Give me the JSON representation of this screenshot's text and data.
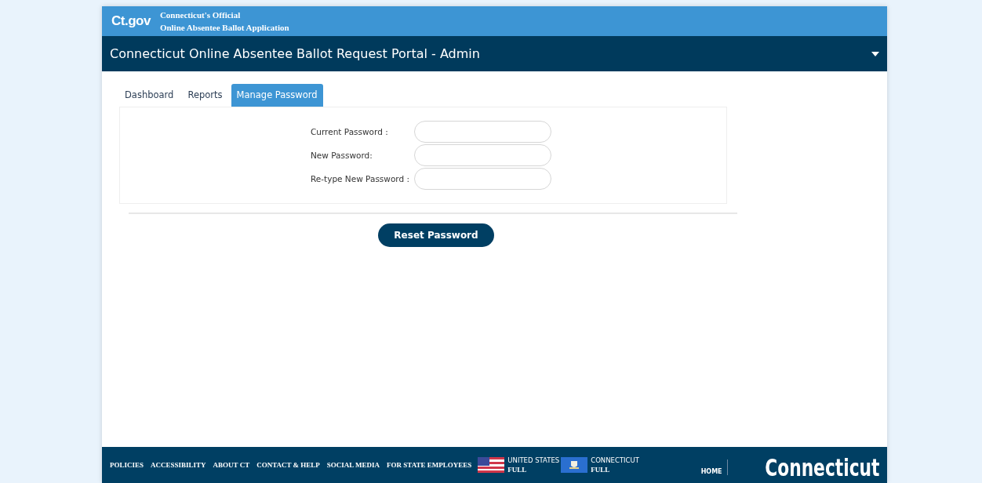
{
  "brand": {
    "logo": "Ct.gov",
    "line_1": "Connecticut's Official",
    "line_2": "Online Absentee Ballot Application"
  },
  "title_bar": {
    "title": "Connecticut Online Absentee Ballot Request Portal - Admin"
  },
  "tabs": [
    {
      "label": "Dashboard",
      "selected": false
    },
    {
      "label": "Reports",
      "selected": false
    },
    {
      "label": "Manage Password",
      "selected": true
    }
  ],
  "form": {
    "fields": [
      {
        "label": "Current Password :"
      },
      {
        "label": "New Password:"
      },
      {
        "label": "Re-type New Password :"
      }
    ],
    "submit": "Reset Password"
  },
  "footer": {
    "links": [
      "POLICIES",
      "ACCESSIBILITY",
      "ABOUT CT",
      "CONTACT & HELP",
      "SOCIAL MEDIA",
      "FOR STATE EMPLOYEES"
    ],
    "flags": [
      {
        "kind": "us",
        "name": "UNITED STATES",
        "status": "FULL"
      },
      {
        "kind": "ct",
        "name": "CONNECTICUT",
        "status": "FULL"
      }
    ],
    "home": "HOME",
    "logo": "Connecticut"
  }
}
